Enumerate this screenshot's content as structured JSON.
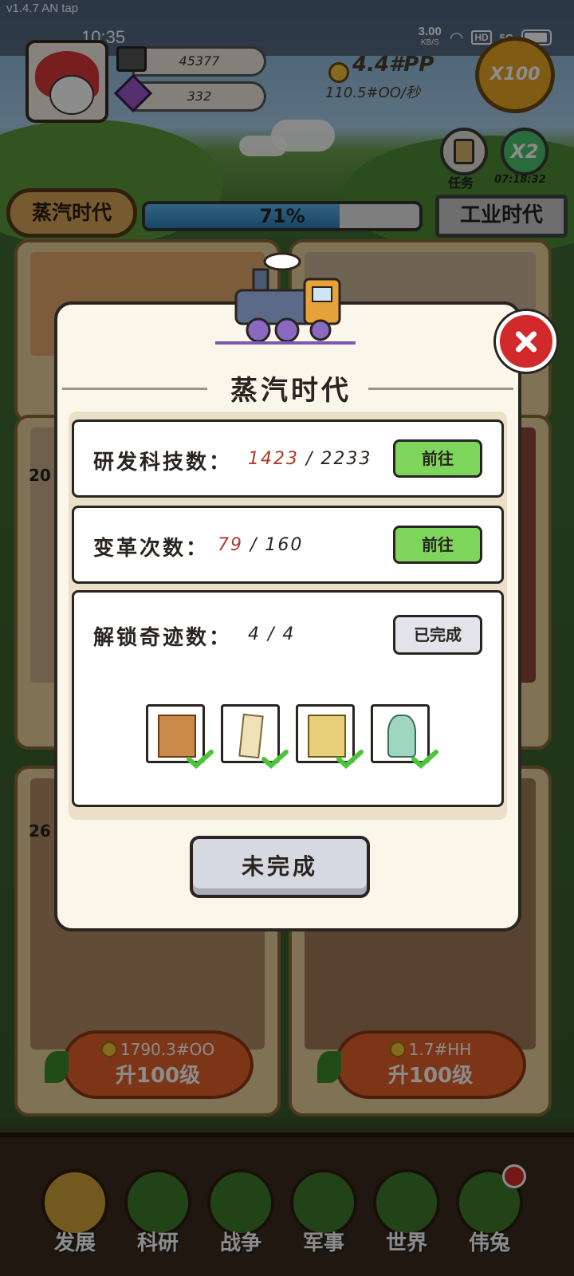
{
  "status_bar": {
    "version": "v1.4.7 AN tap",
    "time": "10:35",
    "net_speed": "3.00",
    "net_unit": "KB/S",
    "hd": "HD",
    "signal": "5G"
  },
  "hud": {
    "iron": "45377",
    "gems": "332",
    "gold": "4.4#PP",
    "gold_rate": "110.5#OO/秒",
    "multiplier": "X100",
    "task_label": "任务",
    "boost_label": "X2",
    "boost_timer": "07:18:32"
  },
  "era": {
    "current": "蒸汽时代",
    "progress": "71%",
    "next": "工业时代"
  },
  "cards": {
    "left_level": "20",
    "left_level_bottom": "26",
    "left_cost": "1790.3#OO",
    "right_cost": "1.7#HH",
    "upgrade_label": "升100级"
  },
  "nav": {
    "items": [
      "发展",
      "科研",
      "战争",
      "军事",
      "世界",
      "伟兔"
    ]
  },
  "dialog": {
    "title": "蒸汽时代",
    "rows": [
      {
        "label": "研发科技数：",
        "current": "1423",
        "sep": " / ",
        "total": "2233",
        "button": "前往"
      },
      {
        "label": "变革次数：",
        "current": "79",
        "sep": " / ",
        "total": "160",
        "button": "前往"
      },
      {
        "label": "解锁奇迹数：",
        "value": "4 / 4",
        "button": "已完成"
      }
    ],
    "wonders": [
      "petra-wonder",
      "pisa-tower-wonder",
      "cathedral-wonder",
      "statue-of-liberty-wonder"
    ],
    "status_button": "未完成"
  },
  "colors": {
    "go_green": "#7ed55c",
    "progress_red": "#b03a2e",
    "close_red": "#d22a2a",
    "check_green": "#4cc43a"
  }
}
